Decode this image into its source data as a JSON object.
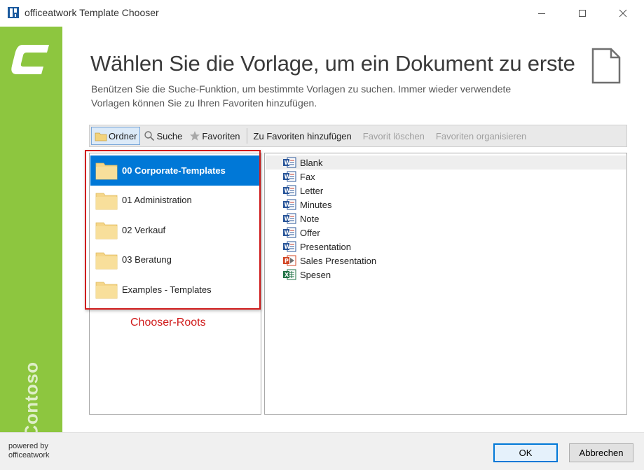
{
  "window": {
    "title": "officeatwork Template Chooser"
  },
  "sidebar": {
    "brand": "Contoso",
    "accent_color": "#8dc63f"
  },
  "header": {
    "title": "Wählen Sie die Vorlage, um ein Dokument zu erste",
    "description_line1": "Benützen Sie die Suche-Funktion, um bestimmte Vorlagen zu suchen. Immer wieder verwendete",
    "description_line2": "Vorlagen können Sie zu Ihren Favoriten hinzufügen."
  },
  "toolbar": {
    "folders_label": "Ordner",
    "search_label": "Suche",
    "favorites_label": "Favoriten",
    "add_favorite_label": "Zu Favoriten hinzufügen",
    "delete_favorite_label": "Favorit löschen",
    "organize_favorites_label": "Favoriten organisieren"
  },
  "roots": [
    {
      "label": "00 Corporate-Templates",
      "selected": true
    },
    {
      "label": "01 Administration",
      "selected": false
    },
    {
      "label": "02 Verkauf",
      "selected": false
    },
    {
      "label": "03 Beratung",
      "selected": false
    },
    {
      "label": "Examples - Templates",
      "selected": false
    }
  ],
  "annotation": {
    "label": "Chooser-Roots",
    "color": "#d01c1c"
  },
  "templates": [
    {
      "label": "Blank",
      "icon": "word-template-icon"
    },
    {
      "label": "Fax",
      "icon": "word-template-icon"
    },
    {
      "label": "Letter",
      "icon": "word-template-icon"
    },
    {
      "label": "Minutes",
      "icon": "word-template-icon"
    },
    {
      "label": "Note",
      "icon": "word-template-icon"
    },
    {
      "label": "Offer",
      "icon": "word-template-icon"
    },
    {
      "label": "Presentation",
      "icon": "word-template-icon"
    },
    {
      "label": "Sales Presentation",
      "icon": "powerpoint-template-icon"
    },
    {
      "label": "Spesen",
      "icon": "excel-template-icon"
    }
  ],
  "footer": {
    "powered_line1": "powered by",
    "powered_line2": "officeatwork",
    "ok_label": "OK",
    "cancel_label": "Abbrechen"
  },
  "colors": {
    "selection": "#0078d7",
    "word": "#2b579a",
    "powerpoint": "#d24726",
    "excel": "#217346"
  }
}
